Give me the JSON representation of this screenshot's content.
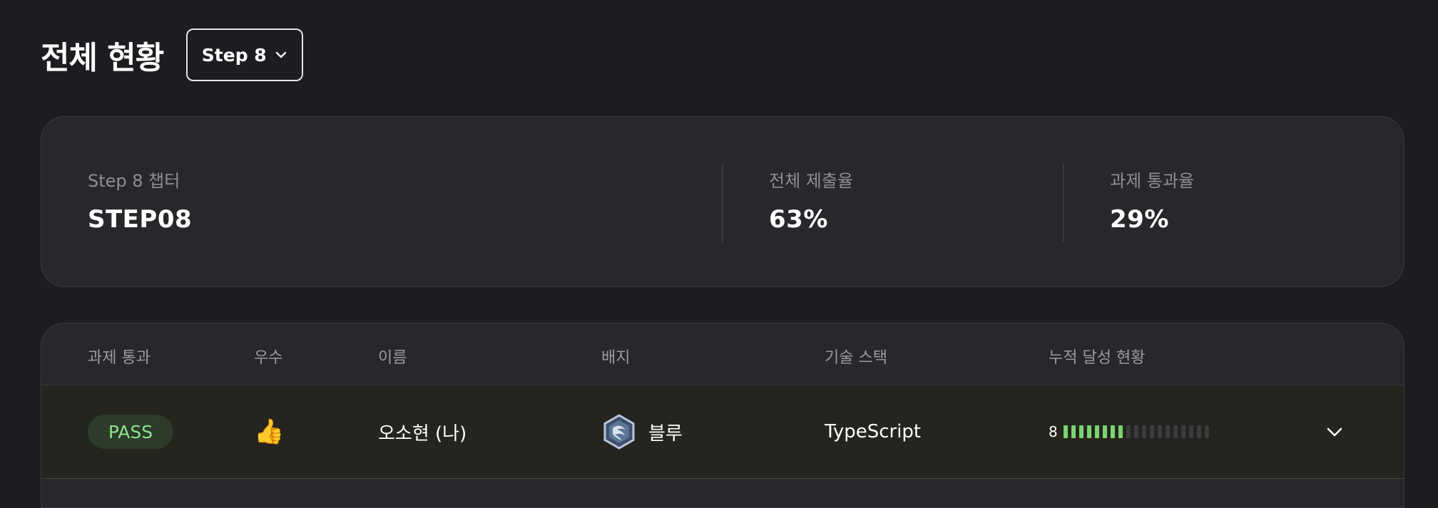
{
  "header": {
    "title": "전체 현황",
    "step_select": "Step 8"
  },
  "summary": {
    "chapter_label": "Step 8 챕터",
    "chapter_value": "STEP08",
    "submission_label": "전체 제출율",
    "submission_value": "63%",
    "pass_label": "과제 통과율",
    "pass_value": "29%"
  },
  "table": {
    "columns": [
      "과제 통과",
      "우수",
      "이름",
      "배지",
      "기술 스택",
      "누적 달성 현황"
    ],
    "rows": [
      {
        "status": "PASS",
        "excellent": "👍",
        "name": "오소현 (나)",
        "badge_icon": "blue-hexagon-badge-icon",
        "badge": "블루",
        "stack": "TypeScript",
        "progress_count": "8",
        "progress_total_segments": 19,
        "progress_filled": 8
      }
    ]
  },
  "colors": {
    "background": "#1c1d20",
    "card": "#27282b",
    "pass_text": "#8ee38b",
    "progress_on": "#7ad46f",
    "progress_off": "#3b3c40"
  }
}
